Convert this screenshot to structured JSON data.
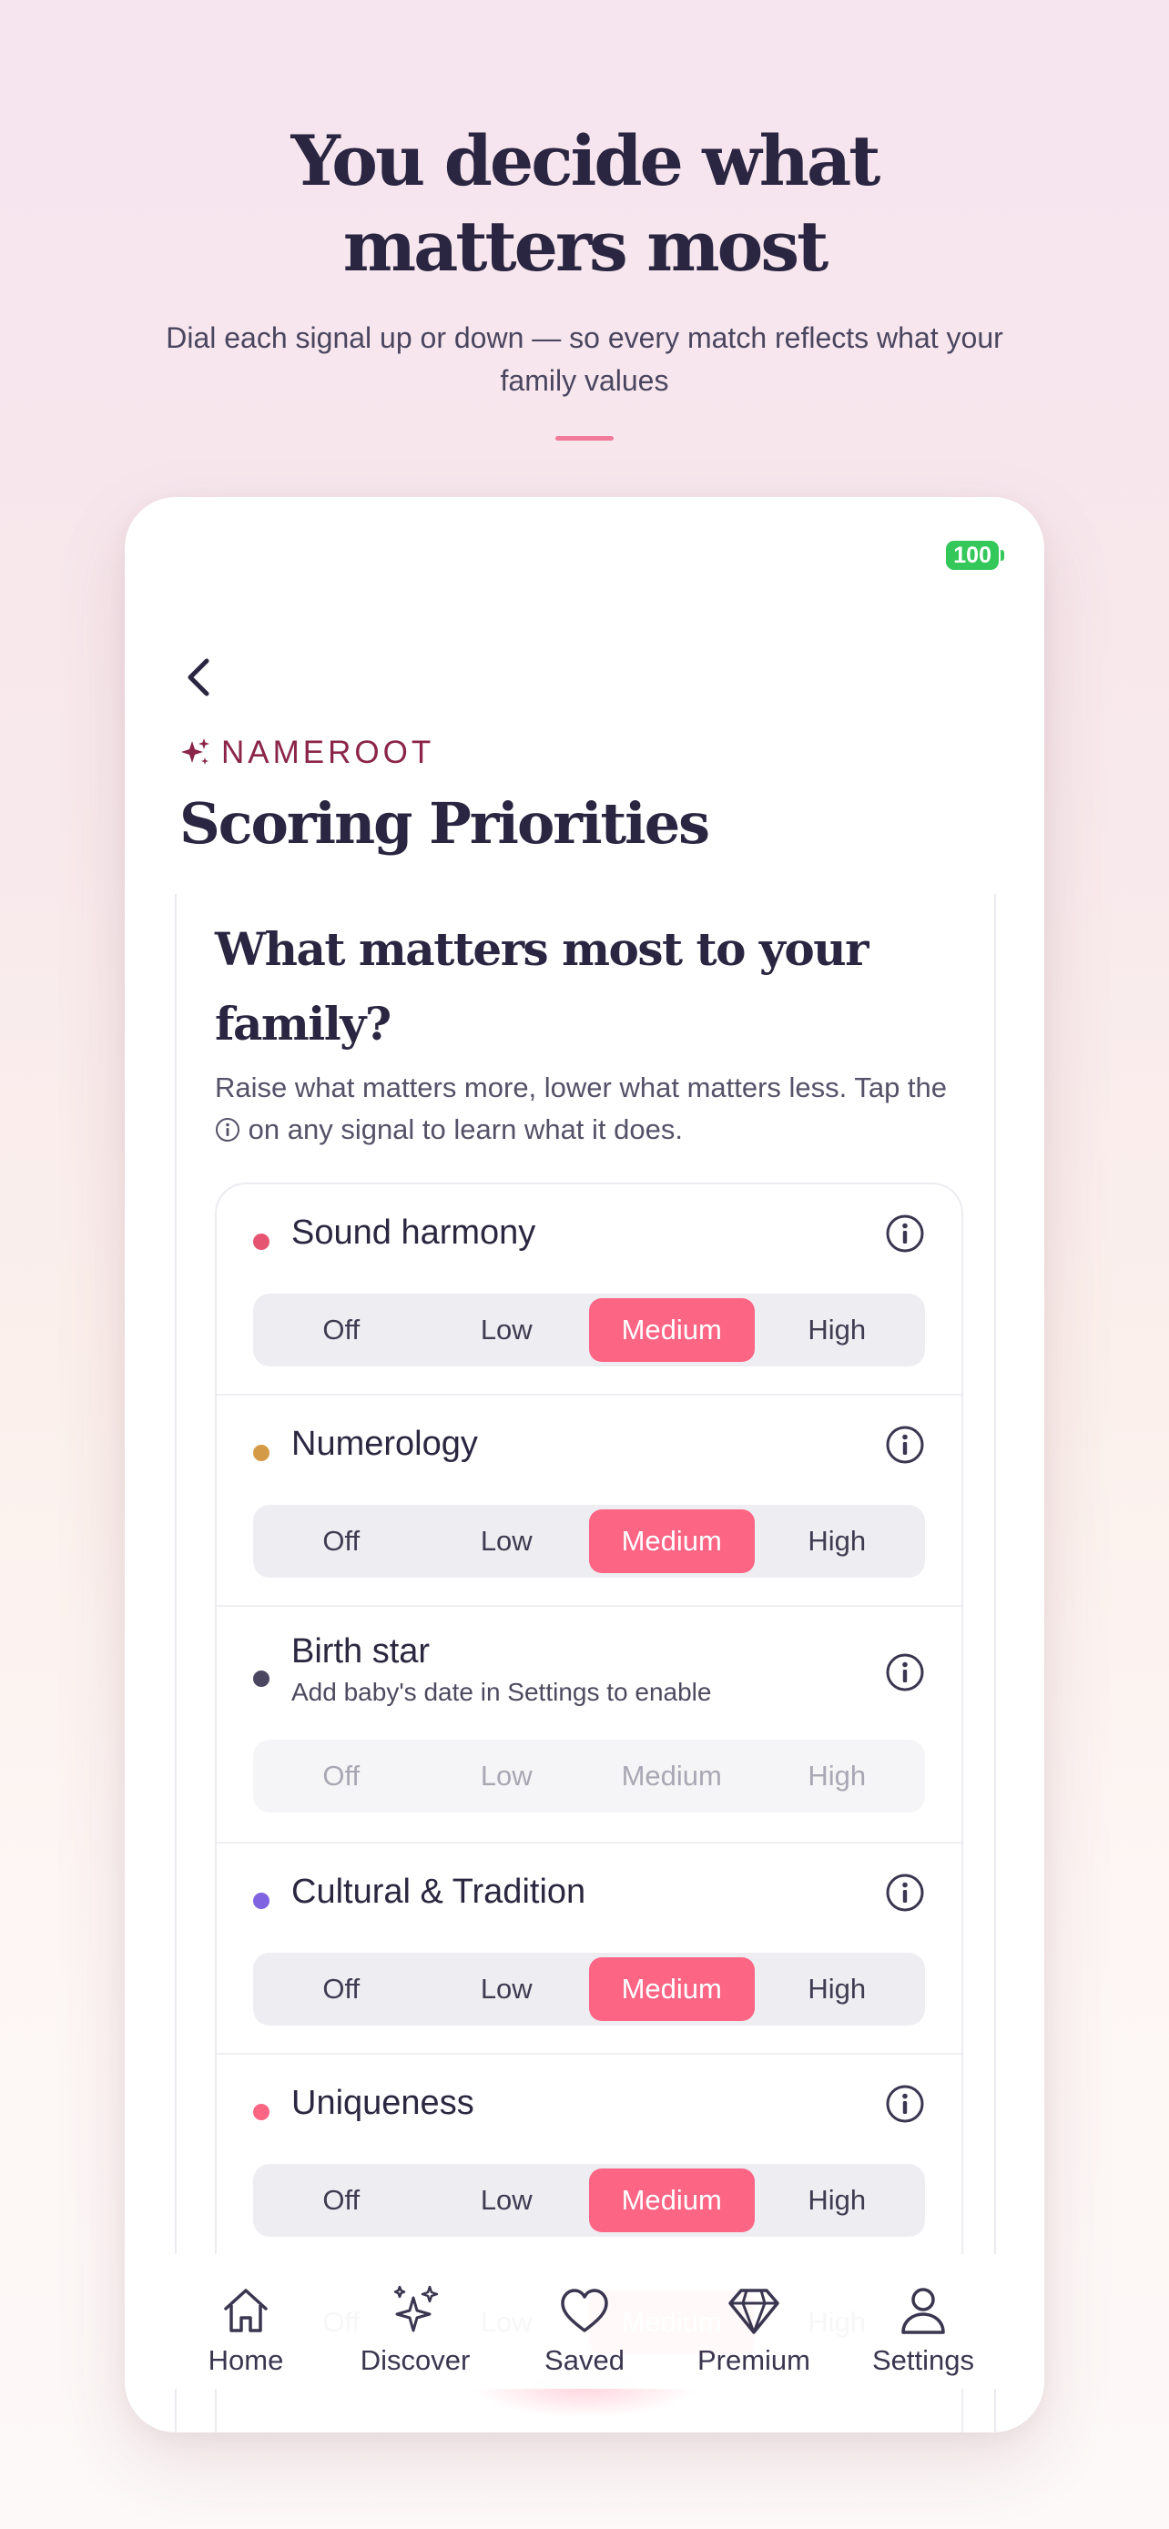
{
  "promo": {
    "title_line1": "You decide what",
    "title_line2": "matters most",
    "subtitle": "Dial each signal up or down — so every match reflects what your family values"
  },
  "status_bar": {
    "battery": "100"
  },
  "header": {
    "brand": "NAMEROOT",
    "title": "Scoring Priorities"
  },
  "section": {
    "title": "What matters most to your family?",
    "desc_before": "Raise what matters more, lower what matters less. Tap the",
    "desc_after": "on any signal to learn what it does."
  },
  "signals": [
    {
      "name": "Sound harmony",
      "dot_color": "#e55572",
      "selected": "Medium",
      "enabled": true
    },
    {
      "name": "Numerology",
      "dot_color": "#d59a45",
      "selected": "Medium",
      "enabled": true
    },
    {
      "name": "Birth star",
      "subtitle": "Add baby's date in Settings to enable",
      "dot_color": "#4a4660",
      "selected": null,
      "enabled": false
    },
    {
      "name": "Cultural & Tradition",
      "dot_color": "#7f63e0",
      "selected": "Medium",
      "enabled": true
    },
    {
      "name": "Uniqueness",
      "dot_color": "#fd6585",
      "selected": "Medium",
      "enabled": true
    },
    {
      "name": "",
      "dot_color": "",
      "selected": "Medium",
      "enabled": true
    }
  ],
  "levels": [
    "Off",
    "Low",
    "Medium",
    "High"
  ],
  "tabs": [
    {
      "label": "Home",
      "icon": "home-icon"
    },
    {
      "label": "Discover",
      "icon": "sparkles-icon"
    },
    {
      "label": "Saved",
      "icon": "heart-icon"
    },
    {
      "label": "Premium",
      "icon": "diamond-icon"
    },
    {
      "label": "Settings",
      "icon": "person-icon"
    }
  ],
  "colors": {
    "accent": "#fd6585",
    "brand": "#8b2449",
    "text_dark": "#2a2540",
    "battery": "#34c759"
  }
}
